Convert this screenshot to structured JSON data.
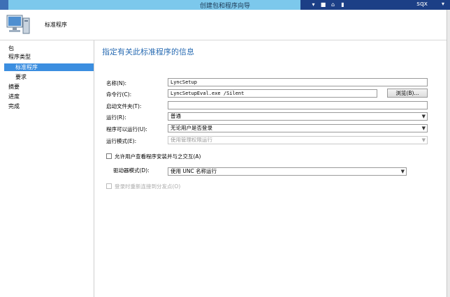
{
  "window": {
    "title": "创建包和程序向导",
    "user": "sqx"
  },
  "header": {
    "title": "标准程序"
  },
  "nav": {
    "items": [
      {
        "label": "包",
        "level": 0,
        "selected": false
      },
      {
        "label": "程序类型",
        "level": 0,
        "selected": false
      },
      {
        "label": "标准程序",
        "level": 1,
        "selected": true
      },
      {
        "label": "要求",
        "level": 1,
        "selected": false
      },
      {
        "label": "摘要",
        "level": 0,
        "selected": false
      },
      {
        "label": "进度",
        "level": 0,
        "selected": false
      },
      {
        "label": "完成",
        "level": 0,
        "selected": false
      }
    ]
  },
  "form": {
    "heading": "指定有关此标准程序的信息",
    "name_label": "名称(N):",
    "name_value": "LyncSetup",
    "cmdline_label": "命令行(C):",
    "cmdline_value": "LyncSetupEval.exe /Silent",
    "browse_label": "浏览(B)...",
    "startin_label": "启动文件夹(T):",
    "startin_value": "",
    "run_label": "运行(R):",
    "run_value": "普通",
    "canrun_label": "程序可以运行(U):",
    "canrun_value": "无论用户是否登录",
    "runmode_label": "运行模式(E):",
    "runmode_value": "使用管理权限运行",
    "allow_label": "允许用户查看程序安装并与之交互(A)",
    "drive_label": "驱动器模式(D):",
    "drive_value": "使用 UNC 名称运行",
    "reconnect_label": "登录时重新连接到分发点(O)"
  }
}
